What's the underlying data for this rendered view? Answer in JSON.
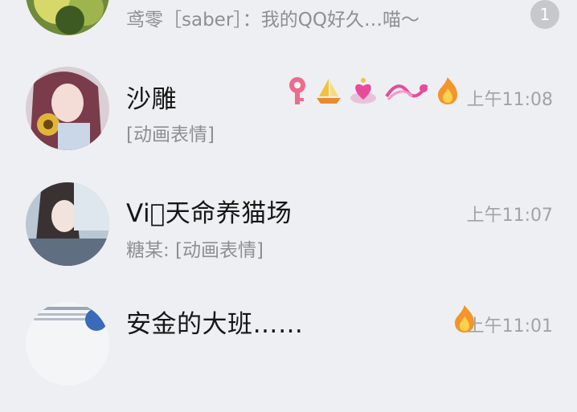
{
  "chat_list": [
    {
      "id": "row1",
      "preview": "鸢零［saber］：我的QQ好久…喵～",
      "unread_count": "1"
    },
    {
      "id": "row2",
      "name": "沙雕",
      "preview": "[动画表情]",
      "time": "上午11:08",
      "badges": [
        "key-badge-icon",
        "sailboat-badge-icon",
        "heart-badge-icon",
        "cupid-badge-icon",
        "fire-badge-icon"
      ]
    },
    {
      "id": "row3",
      "name": "Vi゙天命养猫场",
      "preview": "糖某: [动画表情]",
      "time": "上午11:07"
    },
    {
      "id": "row4",
      "name": "安金的大班……",
      "time": "上午11:01",
      "badges": [
        "fire-badge-icon"
      ]
    }
  ],
  "colors": {
    "background": "#eeeff2",
    "name": "#161616",
    "preview": "#8e8f93",
    "time": "#a2a3a7",
    "unread_badge": "#c7c8cc"
  }
}
